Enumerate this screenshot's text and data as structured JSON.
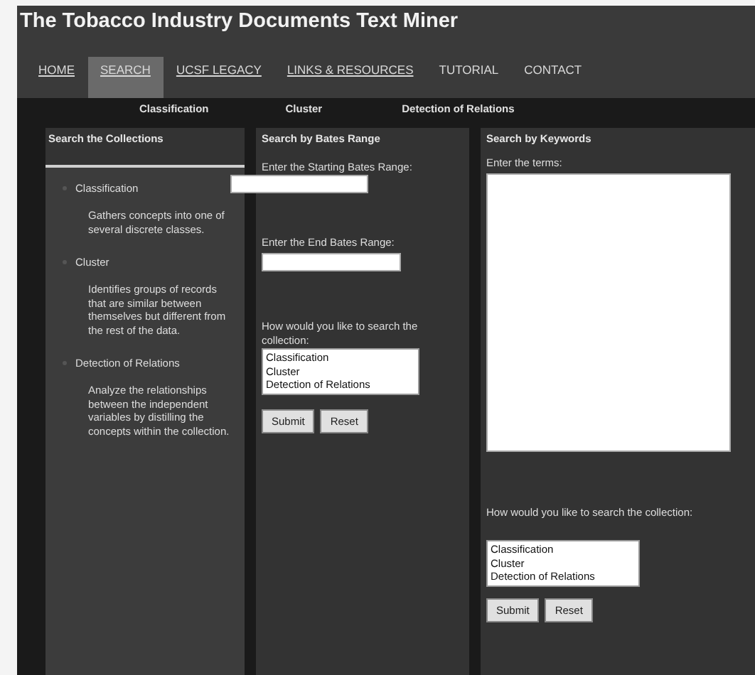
{
  "title": "The Tobacco Industry Documents Text Miner",
  "nav": [
    {
      "label": "HOME",
      "selected": false,
      "underlined": true
    },
    {
      "label": "SEARCH",
      "selected": true,
      "underlined": true
    },
    {
      "label": "UCSF LEGACY",
      "selected": false,
      "underlined": true
    },
    {
      "label": "LINKS & RESOURCES",
      "selected": false,
      "underlined": true
    },
    {
      "label": "TUTORIAL",
      "selected": false,
      "underlined": false
    },
    {
      "label": "CONTACT",
      "selected": false,
      "underlined": false
    }
  ],
  "subnav": [
    "Classification",
    "Cluster",
    "Detection of Relations"
  ],
  "collections": {
    "heading": "Search the Collections",
    "methods": [
      {
        "name": "Classification",
        "description": "Gathers concepts into one of several discrete classes."
      },
      {
        "name": "Cluster",
        "description": "Identifies groups of records that are similar between themselves but different from the rest of the data."
      },
      {
        "name": "Detection of Relations",
        "description": "Analyze the relationships between the independent variables by distilling the concepts within the collection."
      }
    ]
  },
  "bates": {
    "heading": "Search by Bates Range",
    "start_label": "Enter the Starting Bates Range:",
    "end_label": "Enter the End Bates Range:",
    "question": "How would you like to search the collection:",
    "options": [
      "Classification",
      "Cluster",
      "Detection of Relations"
    ],
    "buttons": [
      "Submit",
      "Reset"
    ]
  },
  "keywords": {
    "heading": "Search by Keywords",
    "terms_label": "Enter the terms:",
    "question": "How would you like to search the collection:",
    "options": [
      "Classification",
      "Cluster",
      "Detection of Relations"
    ],
    "buttons": [
      "Submit",
      "Reset"
    ]
  }
}
